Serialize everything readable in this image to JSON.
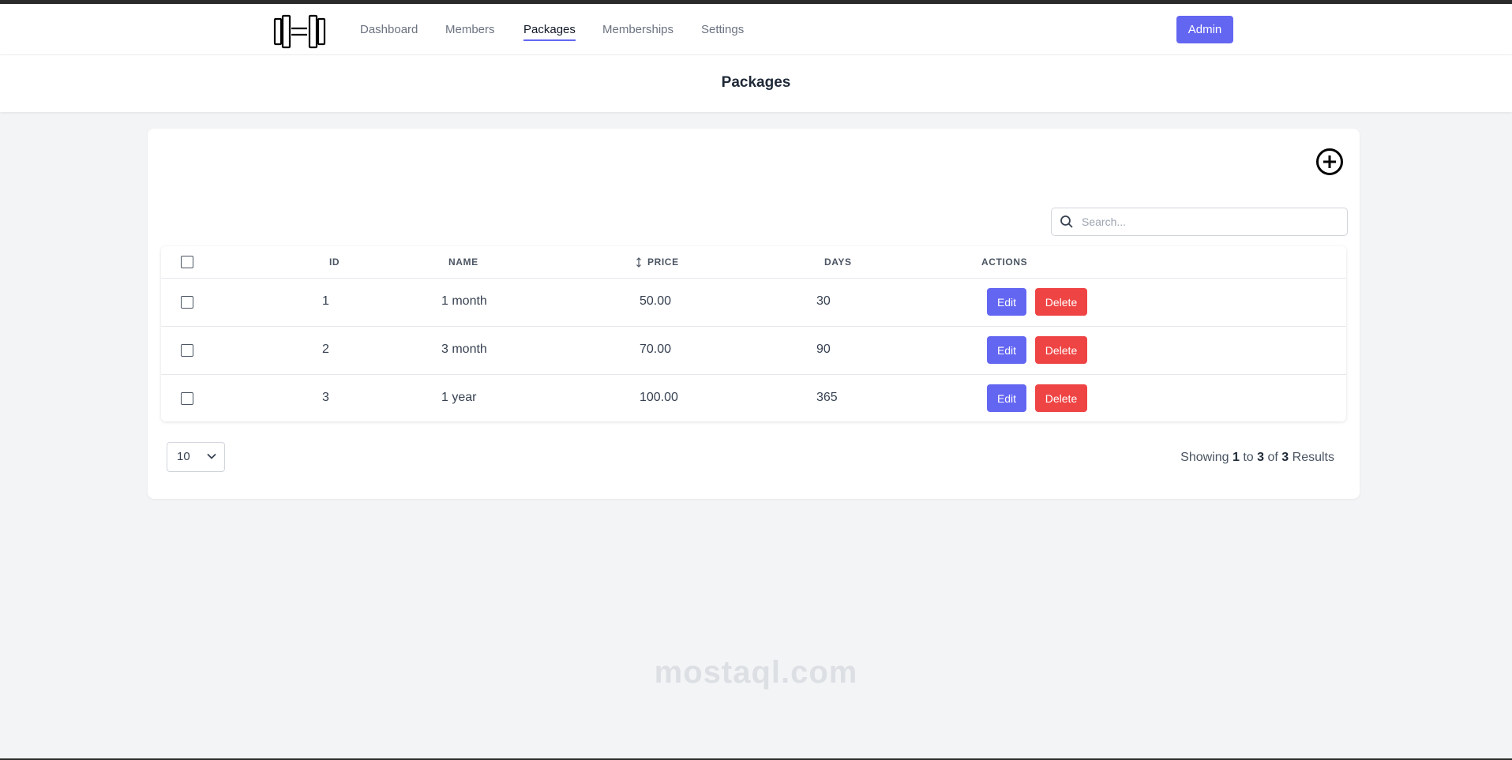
{
  "nav": {
    "links": [
      {
        "label": "Dashboard",
        "active": false
      },
      {
        "label": "Members",
        "active": false
      },
      {
        "label": "Packages",
        "active": true
      },
      {
        "label": "Memberships",
        "active": false
      },
      {
        "label": "Settings",
        "active": false
      }
    ],
    "admin_label": "Admin"
  },
  "header": {
    "title": "Packages"
  },
  "search": {
    "placeholder": "Search..."
  },
  "table": {
    "columns": [
      "ID",
      "NAME",
      "PRICE",
      "DAYS",
      "ACTIONS"
    ],
    "rows": [
      {
        "id": "1",
        "name": "1 month",
        "price": "50.00",
        "days": "30"
      },
      {
        "id": "2",
        "name": "3 month",
        "price": "70.00",
        "days": "90"
      },
      {
        "id": "3",
        "name": "1 year",
        "price": "100.00",
        "days": "365"
      }
    ],
    "edit_label": "Edit",
    "delete_label": "Delete"
  },
  "pagination": {
    "per_page": "10",
    "showing_prefix": "Showing",
    "from": "1",
    "to_word": "to",
    "to": "3",
    "of_word": "of",
    "total": "3",
    "results_word": "Results"
  },
  "watermark": {
    "text": "mostaql.com"
  },
  "colors": {
    "accent": "#6366f1",
    "danger": "#ef4444",
    "background": "#f3f4f6"
  },
  "icons": {
    "logo": "dumbbell-logo-icon",
    "add": "plus-circle-icon",
    "search": "search-icon",
    "sort": "sort-icon",
    "dropdown": "chevron-down-icon"
  }
}
